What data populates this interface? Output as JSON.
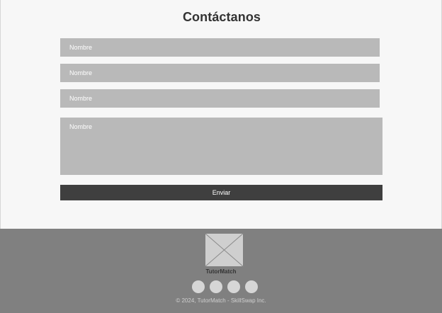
{
  "contact": {
    "title": "Contáctanos",
    "fields": [
      {
        "placeholder": "Nombre"
      },
      {
        "placeholder": "Nombre"
      },
      {
        "placeholder": "Nombre"
      }
    ],
    "message": {
      "placeholder": "Nombre"
    },
    "submit_label": "Enviar"
  },
  "footer": {
    "logo_icon": "image-placeholder-icon",
    "brand": "TutorMatch",
    "social_icons": [
      "social-icon",
      "social-icon",
      "social-icon",
      "social-icon"
    ],
    "copyright": "© 2024, TutorMatch - SkillSwap Inc."
  },
  "colors": {
    "background": "#f7f7f7",
    "input_fill": "#b9b9b9",
    "button_fill": "#3f3f3f",
    "footer_fill": "#808080",
    "social_fill": "#d6d6d6"
  }
}
